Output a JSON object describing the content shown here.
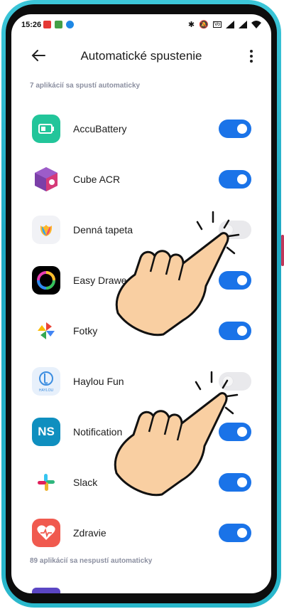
{
  "status_bar": {
    "time": "15:26",
    "icons": [
      "notification-red-icon",
      "notification-green-icon",
      "notification-blue-icon",
      "bluetooth-icon",
      "mute-icon",
      "volte-icon",
      "signal-icon",
      "wifi-icon"
    ]
  },
  "header": {
    "title": "Automatické spustenie",
    "back_icon": "arrow-left-icon",
    "menu_icon": "more-vertical-icon"
  },
  "sections": {
    "enabled_label": "7 aplikácií sa spustí automaticky",
    "disabled_label": "89 aplikácií sa nespustí automaticky"
  },
  "apps": [
    {
      "name": "AccuBattery",
      "enabled": true,
      "icon": "battery-icon"
    },
    {
      "name": "Cube ACR",
      "enabled": true,
      "icon": "cube-icon"
    },
    {
      "name": "Denná tapeta",
      "enabled": false,
      "icon": "tulip-icon"
    },
    {
      "name": "Easy Drawe",
      "enabled": true,
      "icon": "ring-icon"
    },
    {
      "name": "Fotky",
      "enabled": true,
      "icon": "pinwheel-icon"
    },
    {
      "name": "Haylou Fun",
      "enabled": false,
      "icon": "watch-icon"
    },
    {
      "name": "Notification",
      "enabled": true,
      "icon": "ns-icon"
    },
    {
      "name": "Slack",
      "enabled": true,
      "icon": "slack-icon"
    },
    {
      "name": "Zdravie",
      "enabled": true,
      "icon": "heart-icon"
    }
  ],
  "icon_text": {
    "haylou_caption": "HAYLOU",
    "ns_letters": "NS"
  },
  "colors": {
    "toggle_on": "#1a73e8",
    "toggle_off": "#e9e9ec",
    "frame": "#2ab8cc"
  }
}
